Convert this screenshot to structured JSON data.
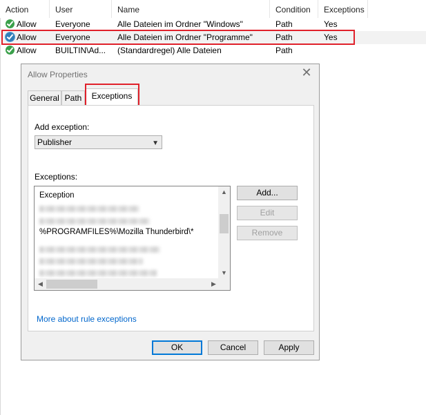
{
  "table": {
    "columns": [
      "Action",
      "User",
      "Name",
      "Condition",
      "Exceptions"
    ],
    "rows": [
      {
        "action": "Allow",
        "user": "Everyone",
        "name": "Alle Dateien im Ordner \"Windows\"",
        "condition": "Path",
        "exceptions": "Yes"
      },
      {
        "action": "Allow",
        "user": "Everyone",
        "name": "Alle Dateien im Ordner \"Programme\"",
        "condition": "Path",
        "exceptions": "Yes"
      },
      {
        "action": "Allow",
        "user": "BUILTIN\\Ad...",
        "name": "(Standardregel) Alle Dateien",
        "condition": "Path",
        "exceptions": ""
      }
    ]
  },
  "dialog": {
    "title": "Allow Properties",
    "close": "✕",
    "tabs": [
      "General",
      "Path",
      "Exceptions"
    ],
    "add_exception_label": "Add exception:",
    "add_exception_value": "Publisher",
    "exceptions_label": "Exceptions:",
    "list_header": "Exception",
    "list_visible_item": "%PROGRAMFILES%\\Mozilla Thunderbird\\*",
    "buttons": {
      "add": "Add...",
      "edit": "Edit",
      "remove": "Remove"
    },
    "link": "More about rule exceptions",
    "footer": {
      "ok": "OK",
      "cancel": "Cancel",
      "apply": "Apply"
    }
  },
  "colors": {
    "highlight": "#e0202a",
    "link": "#0066cc",
    "allow_icon": "#3aa04a"
  }
}
